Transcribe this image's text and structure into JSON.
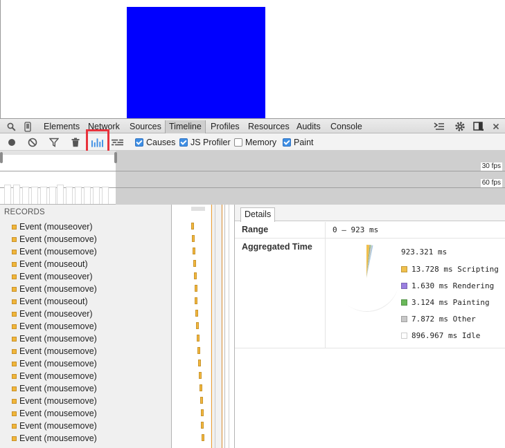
{
  "page": {},
  "devtools": {
    "tabs": [
      "Elements",
      "Network",
      "Sources",
      "Timeline",
      "Profiles",
      "Resources",
      "Audits",
      "Console"
    ],
    "selected_tab": "Timeline"
  },
  "toolbar": {
    "checkboxes": [
      {
        "label": "Causes",
        "checked": true
      },
      {
        "label": "JS Profiler",
        "checked": true
      },
      {
        "label": "Memory",
        "checked": false
      },
      {
        "label": "Paint",
        "checked": true
      }
    ]
  },
  "overview": {
    "fps_labels": [
      "30 fps",
      "60 fps"
    ]
  },
  "records": {
    "header": "RECORDS",
    "items": [
      "Event (mouseover)",
      "Event (mousemove)",
      "Event (mousemove)",
      "Event (mouseout)",
      "Event (mouseover)",
      "Event (mousemove)",
      "Event (mouseout)",
      "Event (mouseover)",
      "Event (mousemove)",
      "Event (mousemove)",
      "Event (mousemove)",
      "Event (mousemove)",
      "Event (mousemove)",
      "Event (mousemove)",
      "Event (mousemove)",
      "Event (mousemove)",
      "Event (mousemove)",
      "Event (mousemove)"
    ]
  },
  "details": {
    "tab": "Details",
    "range_label": "Range",
    "range_value": "0 – 923 ms",
    "aggregated_label": "Aggregated Time",
    "total": "923.321 ms",
    "legend": [
      {
        "label": "13.728 ms Scripting",
        "color": "#f0c04c"
      },
      {
        "label": "1.630 ms Rendering",
        "color": "#9a7fe0"
      },
      {
        "label": "3.124 ms Painting",
        "color": "#6ab85a"
      },
      {
        "label": "7.872 ms Other",
        "color": "#c8c8c8"
      },
      {
        "label": "896.967 ms Idle",
        "color": "#ffffff"
      }
    ]
  },
  "colors": {
    "page_block": "#0000ff",
    "highlight": "#e8323c",
    "record_event": "#f0b63a",
    "checkbox_on": "#3f8fe4"
  }
}
